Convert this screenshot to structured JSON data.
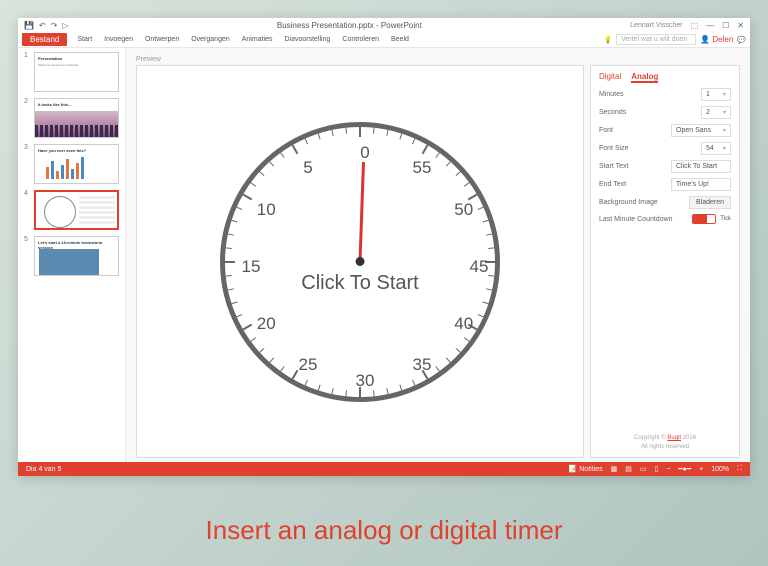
{
  "titlebar": {
    "document": "Business Presentation.pptx - PowerPoint",
    "user": "Lennart Visscher"
  },
  "ribbon": {
    "file": "Bestand",
    "tabs": [
      "Start",
      "Invoegen",
      "Ontwerpen",
      "Overgangen",
      "Animaties",
      "Diavoorstelling",
      "Controleren",
      "Beeld"
    ],
    "tell_me": "Vertel wat u wilt doen",
    "share": "Delen"
  },
  "thumbs": {
    "t1_title": "Presentation",
    "t1_text": "Different categories worldwide",
    "t2_title": "It looks like this...",
    "t3_title": "Have you ever seen this?",
    "t5_title": "Let's start a 15-minute brainstorm session"
  },
  "preview_label": "Preview",
  "clock": {
    "numbers": [
      "0",
      "55",
      "50",
      "45",
      "40",
      "35",
      "30",
      "25",
      "20",
      "15",
      "10",
      "5"
    ],
    "center_text": "Click To Start"
  },
  "panel": {
    "tab_digital": "Digital",
    "tab_analog": "Analog",
    "minutes_label": "Minutes",
    "minutes_val": "1",
    "seconds_label": "Seconds",
    "seconds_val": "2",
    "font_label": "Font",
    "font_val": "Open Sans",
    "fontsize_label": "Font Size",
    "fontsize_val": "54",
    "start_label": "Start Text",
    "start_val": "Click To Start",
    "end_label": "End Text",
    "end_val": "Time's Up!",
    "bg_label": "Background Image",
    "bg_btn": "Bladeren",
    "countdown_label": "Last Minute Countdown",
    "countdown_toggle": "Tick",
    "copyright": "Copyright © ",
    "copyright_link": "Bugit",
    "copyright_year": " 2016",
    "rights": "All rights reserved"
  },
  "status": {
    "left": "Dia 4 van 5",
    "notes": "Notities",
    "zoom": "100%"
  },
  "caption": "Insert an analog or digital timer"
}
